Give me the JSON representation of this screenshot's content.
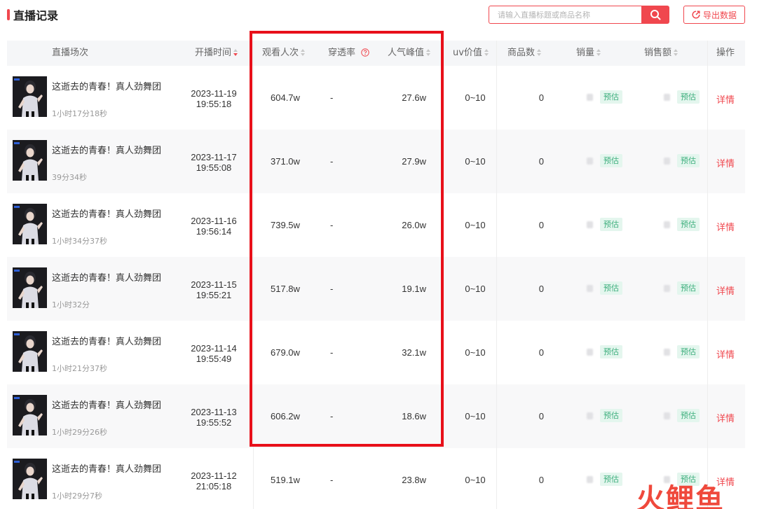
{
  "page_title": "直播记录",
  "search": {
    "placeholder": "请输入直播标题或商品名称"
  },
  "export_label": "导出数据",
  "columns": {
    "session": "直播场次",
    "start_time": "开播时间",
    "views": "观看人次",
    "penetration": "穿透率",
    "peak": "人气峰值",
    "uv": "uv价值",
    "products": "商品数",
    "sales": "销量",
    "revenue": "销售额",
    "actions": "操作"
  },
  "estimate_tag": "预估",
  "detail_label": "详情",
  "rows": [
    {
      "title": "这逝去的青春！真人劲舞团",
      "duration": "1小时17分18秒",
      "date": "2023-11-19",
      "time": "19:55:18",
      "views": "604.7w",
      "penetration": "-",
      "peak": "27.6w",
      "uv": "0~10",
      "products": "0"
    },
    {
      "title": "这逝去的青春！真人劲舞团",
      "duration": "39分34秒",
      "date": "2023-11-17",
      "time": "19:55:08",
      "views": "371.0w",
      "penetration": "-",
      "peak": "27.9w",
      "uv": "0~10",
      "products": "0"
    },
    {
      "title": "这逝去的青春！真人劲舞团",
      "duration": "1小时34分37秒",
      "date": "2023-11-16",
      "time": "19:56:14",
      "views": "739.5w",
      "penetration": "-",
      "peak": "26.0w",
      "uv": "0~10",
      "products": "0"
    },
    {
      "title": "这逝去的青春！真人劲舞团",
      "duration": "1小时32分",
      "date": "2023-11-15",
      "time": "19:55:21",
      "views": "517.8w",
      "penetration": "-",
      "peak": "19.1w",
      "uv": "0~10",
      "products": "0"
    },
    {
      "title": "这逝去的青春！真人劲舞团",
      "duration": "1小时21分37秒",
      "date": "2023-11-14",
      "time": "19:55:49",
      "views": "679.0w",
      "penetration": "-",
      "peak": "32.1w",
      "uv": "0~10",
      "products": "0"
    },
    {
      "title": "这逝去的青春！真人劲舞团",
      "duration": "1小时29分26秒",
      "date": "2023-11-13",
      "time": "19:55:52",
      "views": "606.2w",
      "penetration": "-",
      "peak": "18.6w",
      "uv": "0~10",
      "products": "0"
    },
    {
      "title": "这逝去的青春！真人劲舞团",
      "duration": "1小时29分7秒",
      "date": "2023-11-12",
      "time": "21:05:18",
      "views": "519.1w",
      "penetration": "-",
      "peak": "23.8w",
      "uv": "0~10",
      "products": "0"
    }
  ],
  "watermark": "火鲤鱼",
  "colors": {
    "accent": "#f0474e",
    "highlight": "#e8101a",
    "tag_bg": "#e4f6ee",
    "tag_text": "#3cae7c"
  }
}
